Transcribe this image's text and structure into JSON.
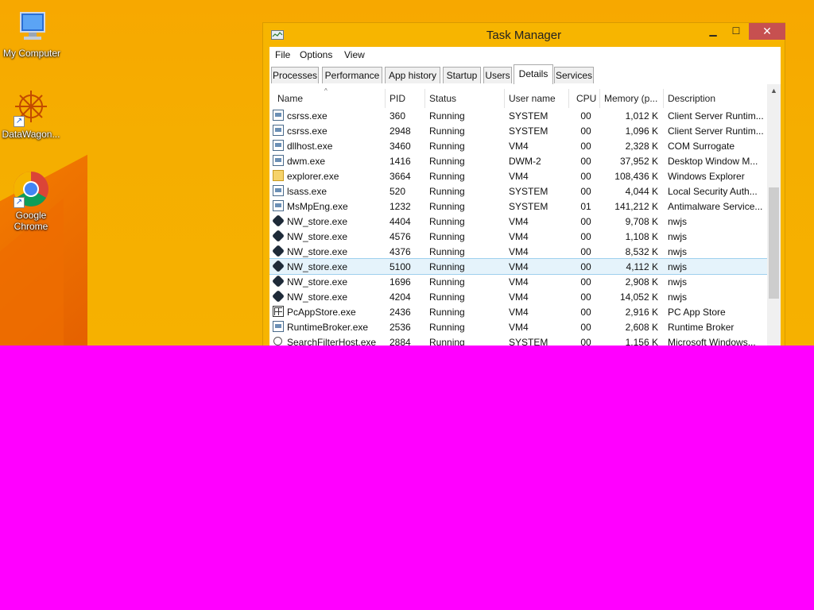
{
  "desktop": {
    "icons": [
      {
        "label": "My Computer",
        "icon": "computer-icon"
      },
      {
        "label": "DataWagon...",
        "icon": "datawagon-icon"
      },
      {
        "label": "Google Chrome",
        "icon": "chrome-icon"
      }
    ]
  },
  "window": {
    "title": "Task Manager",
    "controls": {
      "minimize": "▁",
      "maximize": "☐",
      "close": "✕"
    }
  },
  "menu": [
    "File",
    "Options",
    "View"
  ],
  "tabs": [
    "Processes",
    "Performance",
    "App history",
    "Startup",
    "Users",
    "Details",
    "Services"
  ],
  "active_tab": "Details",
  "table": {
    "sort_indicator": "^",
    "columns": [
      "Name",
      "PID",
      "Status",
      "User name",
      "CPU",
      "Memory (p...",
      "Description"
    ],
    "rows": [
      {
        "name": "csrss.exe",
        "pid": "360",
        "status": "Running",
        "user": "SYSTEM",
        "cpu": "00",
        "mem": "1,012 K",
        "desc": "Client Server Runtim...",
        "icon": "exe"
      },
      {
        "name": "csrss.exe",
        "pid": "2948",
        "status": "Running",
        "user": "SYSTEM",
        "cpu": "00",
        "mem": "1,096 K",
        "desc": "Client Server Runtim...",
        "icon": "exe"
      },
      {
        "name": "dllhost.exe",
        "pid": "3460",
        "status": "Running",
        "user": "VM4",
        "cpu": "00",
        "mem": "2,328 K",
        "desc": "COM Surrogate",
        "icon": "exe"
      },
      {
        "name": "dwm.exe",
        "pid": "1416",
        "status": "Running",
        "user": "DWM-2",
        "cpu": "00",
        "mem": "37,952 K",
        "desc": "Desktop Window M...",
        "icon": "exe"
      },
      {
        "name": "explorer.exe",
        "pid": "3664",
        "status": "Running",
        "user": "VM4",
        "cpu": "00",
        "mem": "108,436 K",
        "desc": "Windows Explorer",
        "icon": "exp"
      },
      {
        "name": "lsass.exe",
        "pid": "520",
        "status": "Running",
        "user": "SYSTEM",
        "cpu": "00",
        "mem": "4,044 K",
        "desc": "Local Security Auth...",
        "icon": "exe"
      },
      {
        "name": "MsMpEng.exe",
        "pid": "1232",
        "status": "Running",
        "user": "SYSTEM",
        "cpu": "01",
        "mem": "141,212 K",
        "desc": "Antimalware Service...",
        "icon": "exe"
      },
      {
        "name": "NW_store.exe",
        "pid": "4404",
        "status": "Running",
        "user": "VM4",
        "cpu": "00",
        "mem": "9,708 K",
        "desc": "nwjs",
        "icon": "nw"
      },
      {
        "name": "NW_store.exe",
        "pid": "4576",
        "status": "Running",
        "user": "VM4",
        "cpu": "00",
        "mem": "1,108 K",
        "desc": "nwjs",
        "icon": "nw"
      },
      {
        "name": "NW_store.exe",
        "pid": "4376",
        "status": "Running",
        "user": "VM4",
        "cpu": "00",
        "mem": "8,532 K",
        "desc": "nwjs",
        "icon": "nw"
      },
      {
        "name": "NW_store.exe",
        "pid": "5100",
        "status": "Running",
        "user": "VM4",
        "cpu": "00",
        "mem": "4,112 K",
        "desc": "nwjs",
        "icon": "nw",
        "selected": true
      },
      {
        "name": "NW_store.exe",
        "pid": "1696",
        "status": "Running",
        "user": "VM4",
        "cpu": "00",
        "mem": "2,908 K",
        "desc": "nwjs",
        "icon": "nw"
      },
      {
        "name": "NW_store.exe",
        "pid": "4204",
        "status": "Running",
        "user": "VM4",
        "cpu": "00",
        "mem": "14,052 K",
        "desc": "nwjs",
        "icon": "nw"
      },
      {
        "name": "PcAppStore.exe",
        "pid": "2436",
        "status": "Running",
        "user": "VM4",
        "cpu": "00",
        "mem": "2,916 K",
        "desc": "PC App Store",
        "icon": "store"
      },
      {
        "name": "RuntimeBroker.exe",
        "pid": "2536",
        "status": "Running",
        "user": "VM4",
        "cpu": "00",
        "mem": "2,608 K",
        "desc": "Runtime Broker",
        "icon": "exe"
      },
      {
        "name": "SearchFilterHost.exe",
        "pid": "2884",
        "status": "Running",
        "user": "SYSTEM",
        "cpu": "00",
        "mem": "1,156 K",
        "desc": "Microsoft Windows...",
        "icon": "search"
      }
    ]
  },
  "colors": {
    "desktop_bg": "#f6ad00",
    "selection": "#e5f3fb",
    "close_button": "#c75050",
    "mask": "#ff00ff"
  }
}
